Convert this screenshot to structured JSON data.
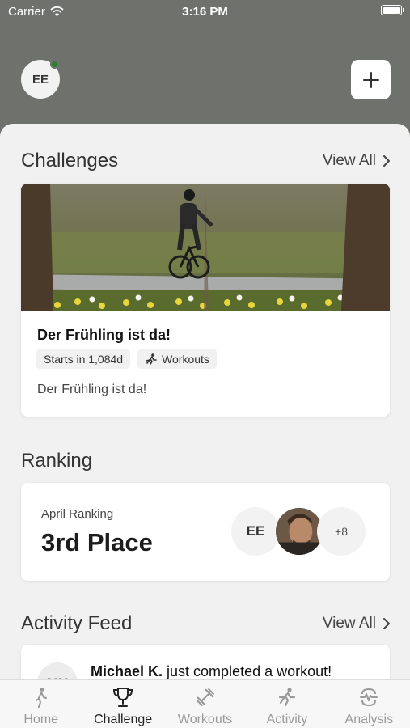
{
  "status_bar": {
    "carrier": "Carrier",
    "time": "3:16 PM"
  },
  "header": {
    "avatar_initials": "EE"
  },
  "challenges": {
    "title": "Challenges",
    "view_all": "View All",
    "card": {
      "title": "Der Frühling ist da!",
      "tags": [
        "Starts in 1,084d",
        "Workouts"
      ],
      "description": "Der Frühling ist da!"
    }
  },
  "ranking": {
    "title": "Ranking",
    "label": "April Ranking",
    "value": "3rd Place",
    "participants": {
      "first_initials": "EE",
      "more": "+8"
    }
  },
  "activity_feed": {
    "title": "Activity Feed",
    "view_all": "View All",
    "item": {
      "initials": "MK",
      "user": "Michael K.",
      "action": " just completed a workout!"
    }
  },
  "tabs": [
    {
      "label": "Home",
      "icon": "walking-person-icon",
      "active": false
    },
    {
      "label": "Challenge",
      "icon": "trophy-icon",
      "active": true
    },
    {
      "label": "Workouts",
      "icon": "dumbbell-icon",
      "active": false
    },
    {
      "label": "Activity",
      "icon": "running-person-icon",
      "active": false
    },
    {
      "label": "Analysis",
      "icon": "analysis-icon",
      "active": false
    }
  ],
  "colors": {
    "header_bg": "#6f716c",
    "online": "#2e7d32",
    "sheet_bg": "#f1f1f1",
    "active_tab": "#222222",
    "inactive_tab": "#9a9a9a"
  }
}
